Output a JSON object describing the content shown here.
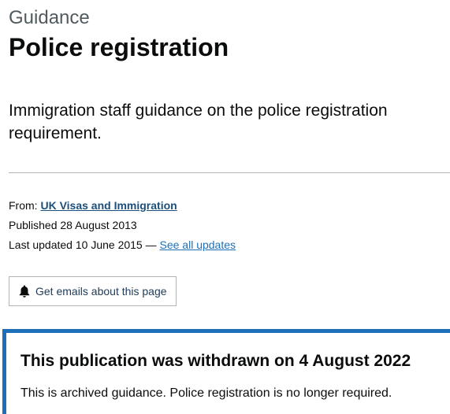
{
  "header": {
    "caption": "Guidance",
    "title": "Police registration"
  },
  "summary": "Immigration staff guidance on the police registration requirement.",
  "metadata": {
    "from_label": "From:",
    "from_link": "UK Visas and Immigration",
    "published_label": "Published",
    "published_date": "28 August 2013",
    "updated_label": "Last updated",
    "updated_date": "10 June 2015",
    "updated_separator": "—",
    "see_all_updates": "See all updates"
  },
  "email_button": {
    "label": "Get emails about this page",
    "icon": "bell-icon"
  },
  "withdrawn_notice": {
    "title": "This publication was withdrawn on 4 August 2022",
    "body": "This is archived guidance. Police registration is no longer required."
  },
  "colors": {
    "link": "#1d70b8",
    "notice_border": "#1d70b8",
    "caption": "#505a5f",
    "text": "#0b0c0c"
  }
}
